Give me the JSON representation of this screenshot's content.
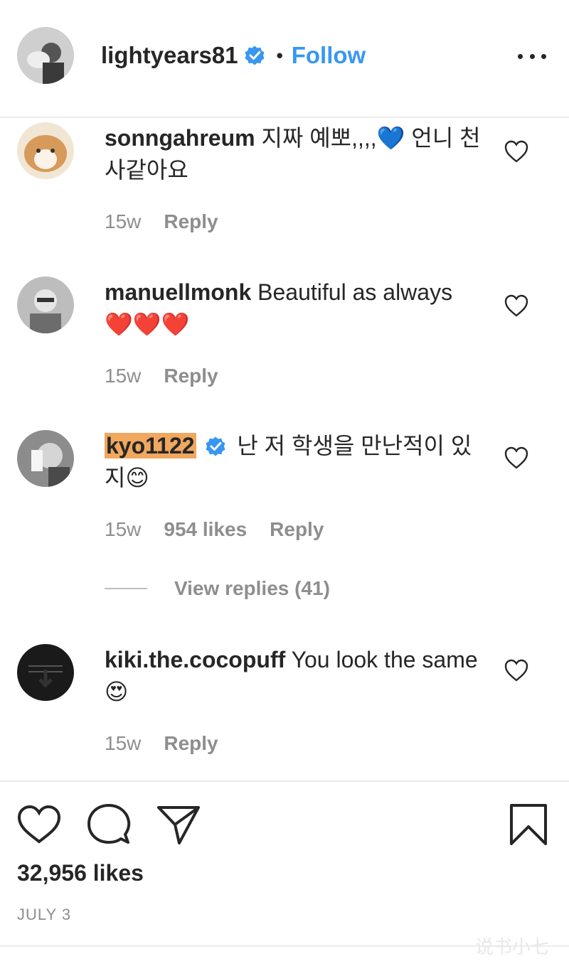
{
  "header": {
    "username": "lightyears81",
    "separator": "•",
    "follow_label": "Follow"
  },
  "comments": [
    {
      "username": "sonngahreum",
      "text": "지짜 예뽀,,,,💙 언니 천사같아요",
      "time": "15w",
      "likes": "",
      "reply_label": "Reply",
      "verified": false,
      "highlighted": false
    },
    {
      "username": "manuellmonk",
      "text": "Beautiful as always ❤️❤️❤️",
      "time": "15w",
      "likes": "",
      "reply_label": "Reply",
      "verified": false,
      "highlighted": false
    },
    {
      "username": "kyo1122",
      "text": "난 저 학생을 만난적이 있지😊",
      "time": "15w",
      "likes": "954 likes",
      "reply_label": "Reply",
      "verified": true,
      "highlighted": true
    },
    {
      "username": "kiki.the.cocopuff",
      "text": "You look the same 😍",
      "time": "15w",
      "likes": "",
      "reply_label": "Reply",
      "verified": false,
      "highlighted": false
    }
  ],
  "view_replies": "View replies (41)",
  "footer": {
    "likes": "32,956 likes",
    "date": "JULY 3"
  },
  "watermark": "说书小七",
  "colors": {
    "link_blue": "#3897f0",
    "verified_blue": "#3897f0",
    "highlight": "#f0a75e",
    "muted": "#8e8e8e"
  }
}
